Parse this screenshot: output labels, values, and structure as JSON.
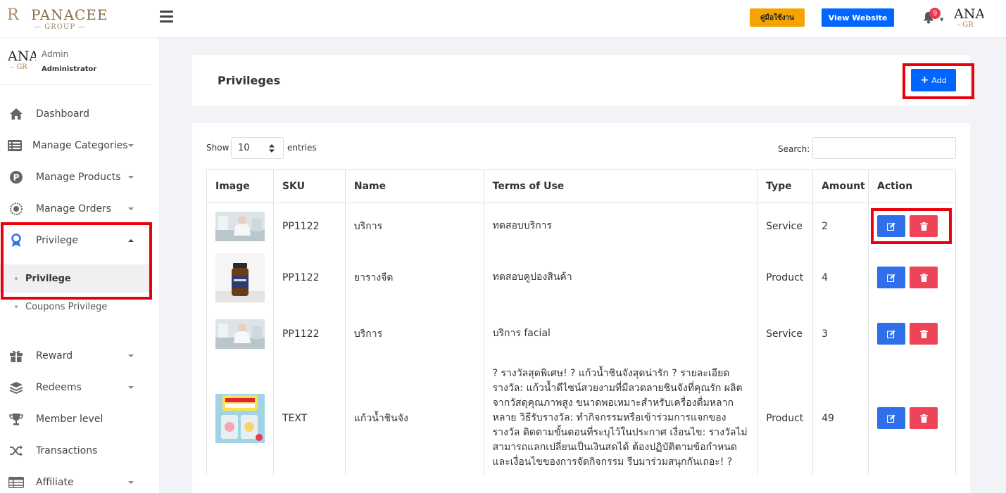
{
  "header": {
    "brand": "PANACEE",
    "brand_sub": "GROUP",
    "manual_button": "คู่มือใช้งาน",
    "view_website_button": "View Website",
    "notification_count": "9",
    "avatar_text": "ANA",
    "avatar_sub": "GR"
  },
  "sidebar": {
    "user": {
      "role": "Admin",
      "title": "Administrator",
      "avatar_text": "ANA",
      "avatar_sub": "GR"
    },
    "items": [
      {
        "label": "Dashboard",
        "icon": "home-icon"
      },
      {
        "label": "Manage Categories",
        "icon": "list-icon"
      },
      {
        "label": "Manage Products",
        "icon": "product-p-icon"
      },
      {
        "label": "Manage Orders",
        "icon": "orders-icon"
      },
      {
        "label": "Privilege",
        "icon": "award-icon"
      },
      {
        "label": "Reward",
        "icon": "gift-icon"
      },
      {
        "label": "Redeems",
        "icon": "layers-icon"
      },
      {
        "label": "Member level",
        "icon": "trophy-icon"
      },
      {
        "label": "Transactions",
        "icon": "shuffle-icon"
      },
      {
        "label": "Affiliate",
        "icon": "table-icon"
      }
    ],
    "privilege_sub": [
      {
        "label": "Privilege"
      },
      {
        "label": "Coupons Privilege"
      }
    ]
  },
  "page": {
    "title": "Privileges",
    "add_button": "Add",
    "show_label": "Show",
    "show_value": "10",
    "entries_label": "entries",
    "search_label": "Search:"
  },
  "table": {
    "columns": [
      "Image",
      "SKU",
      "Name",
      "Terms of Use",
      "Type",
      "Amount",
      "Action"
    ],
    "rows": [
      {
        "image": "woman-photo",
        "sku": "PP1122",
        "name": "บริการ",
        "terms": "ทดสอบบริการ",
        "type": "Service",
        "amount": "2"
      },
      {
        "image": "bottle-photo",
        "sku": "PP1122",
        "name": "ยารางจืด",
        "terms": "ทดสอบคูปองสินค้า",
        "type": "Product",
        "amount": "4"
      },
      {
        "image": "woman-photo",
        "sku": "PP1122",
        "name": "บริการ",
        "terms": "บริการ facial",
        "type": "Service",
        "amount": "3"
      },
      {
        "image": "glass-promo-photo",
        "sku": "TEXT",
        "name": "แก้วน้ำชินจัง",
        "terms": "? รางวัลสุดพิเศษ! ? แก้วน้ำชินจังสุดน่ารัก ? รายละเอียดรางวัล: แก้วน้ำดีไซน์สวยงามที่มีลวดลายชินจังที่คุณรัก ผลิตจากวัสดุคุณภาพสูง ขนาดพอเหมาะสำหรับเครื่องดื่มหลากหลาย วิธีรับรางวัล: ทำกิจกรรมหรือเข้าร่วมการแจกของรางวัล ติดตามขั้นตอนที่ระบุไว้ในประกาศ เงื่อนไข: รางวัลไม่สามารถแลกเปลี่ยนเป็นเงินสดได้ ต้องปฏิบัติตามข้อกำหนดและเงื่อนไขของการจัดกิจกรรม รีบมาร่วมสนุกกันเถอะ! ?",
        "type": "Product",
        "amount": "49"
      }
    ]
  },
  "colors": {
    "primary": "#0066ff",
    "manual": "#f5a300",
    "edit": "#2f6fea",
    "delete": "#ee4459",
    "highlight": "#e8000b",
    "privilege_active": "#2f6fea"
  }
}
